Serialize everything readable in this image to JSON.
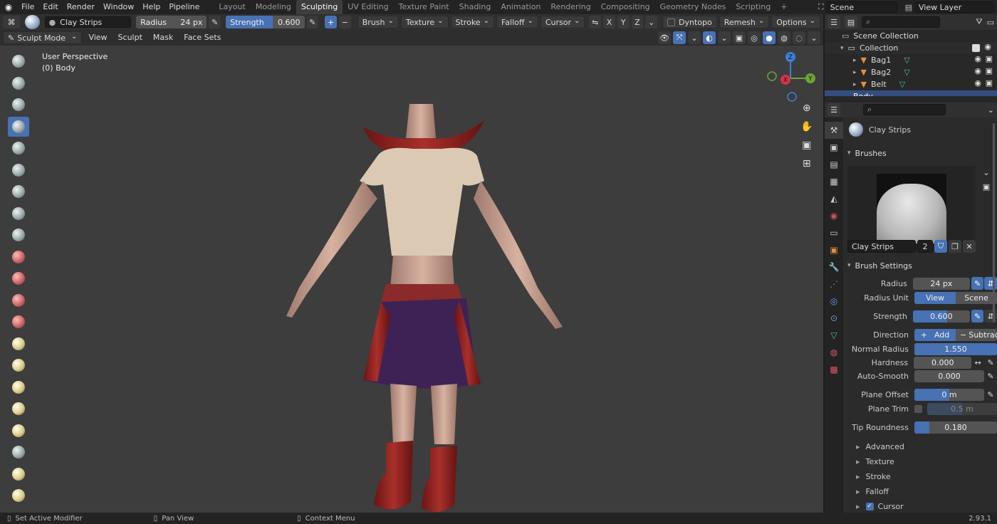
{
  "topbar": {
    "menus": [
      "File",
      "Edit",
      "Render",
      "Window",
      "Help",
      "Pipeline"
    ],
    "workspaces": [
      "Layout",
      "Modeling",
      "Sculpting",
      "UV Editing",
      "Texture Paint",
      "Shading",
      "Animation",
      "Rendering",
      "Compositing",
      "Geometry Nodes",
      "Scripting"
    ],
    "active_workspace": "Sculpting",
    "add_workspace": "+",
    "scene": "Scene",
    "view_layer": "View Layer"
  },
  "toolheader": {
    "brush_name": "Clay Strips",
    "radius_label": "Radius",
    "radius_value": "24 px",
    "strength_label": "Strength",
    "strength_value": "0.600",
    "strength_fraction": 0.6,
    "plus": "+",
    "minus": "−",
    "menus": [
      "Brush",
      "Texture",
      "Stroke",
      "Falloff",
      "Cursor"
    ],
    "axes": [
      "X",
      "Y",
      "Z"
    ],
    "dyntopo": "Dyntopo",
    "remesh": "Remesh",
    "options": "Options"
  },
  "viewheader": {
    "mode": "Sculpt Mode",
    "menus": [
      "View",
      "Sculpt",
      "Mask",
      "Face Sets"
    ]
  },
  "viewport": {
    "perspective": "User Perspective",
    "object": "(0) Body",
    "gizmo": {
      "x": "X",
      "y": "Y",
      "z": "Z"
    }
  },
  "outliner": {
    "root": "Scene Collection",
    "collection": "Collection",
    "items": [
      {
        "name": "Bag1",
        "selected": false
      },
      {
        "name": "Bag2",
        "selected": false
      },
      {
        "name": "Belt",
        "selected": false
      },
      {
        "name": "Body",
        "selected": true
      }
    ]
  },
  "properties": {
    "brush_header": "Clay Strips",
    "brushes_panel": "Brushes",
    "brush_field": "Clay Strips",
    "brush_users": "2",
    "brush_settings_panel": "Brush Settings",
    "radius": {
      "label": "Radius",
      "value": "24 px"
    },
    "radius_unit": {
      "label": "Radius Unit",
      "options": [
        "View",
        "Scene"
      ],
      "active": "View"
    },
    "strength": {
      "label": "Strength",
      "value": "0.600",
      "fraction": 0.6
    },
    "direction": {
      "label": "Direction",
      "add": "Add",
      "subtract": "Subtract"
    },
    "normal_radius": {
      "label": "Normal Radius",
      "value": "1.550",
      "fraction": 1.0
    },
    "hardness": {
      "label": "Hardness",
      "value": "0.000",
      "fraction": 0
    },
    "auto_smooth": {
      "label": "Auto-Smooth",
      "value": "0.000",
      "fraction": 0
    },
    "plane_offset": {
      "label": "Plane Offset",
      "value": "0 m",
      "fraction": 0.5
    },
    "plane_trim": {
      "label": "Plane Trim",
      "value": "0.5 m",
      "fraction": 0.5
    },
    "tip_roundness": {
      "label": "Tip Roundness",
      "value": "0.180",
      "fraction": 0.18
    },
    "subpanels": [
      "Advanced",
      "Texture",
      "Stroke",
      "Falloff",
      "Cursor"
    ]
  },
  "status": {
    "left": "Set Active Modifier",
    "mid": "Pan View",
    "right": "Context Menu",
    "version": "2.93.1"
  },
  "colors": {
    "accent": "#4772b3",
    "viewport": "#3d3d3d",
    "panel": "#2b2b2b"
  }
}
